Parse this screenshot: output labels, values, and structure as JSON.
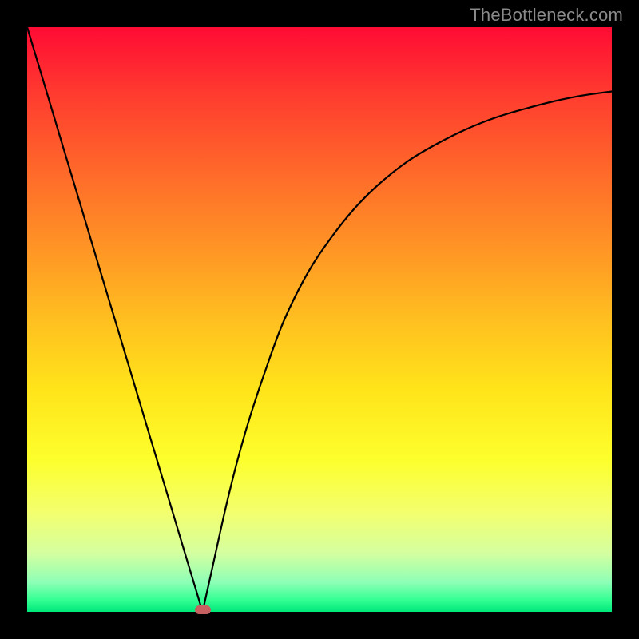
{
  "watermark": "TheBottleneck.com",
  "chart_data": {
    "type": "line",
    "title": "",
    "xlabel": "",
    "ylabel": "",
    "xlim": [
      0,
      100
    ],
    "ylim": [
      0,
      100
    ],
    "grid": false,
    "legend": false,
    "min_marker": {
      "x": 30,
      "y": 0
    },
    "gradient_stops": [
      {
        "pct": 0,
        "color": "#ff0b34"
      },
      {
        "pct": 12,
        "color": "#ff3d2f"
      },
      {
        "pct": 25,
        "color": "#ff6a2a"
      },
      {
        "pct": 38,
        "color": "#ff9525"
      },
      {
        "pct": 50,
        "color": "#ffbf20"
      },
      {
        "pct": 62,
        "color": "#ffe41a"
      },
      {
        "pct": 74,
        "color": "#fdff2c"
      },
      {
        "pct": 83,
        "color": "#f3ff6e"
      },
      {
        "pct": 90,
        "color": "#d4ffa0"
      },
      {
        "pct": 95,
        "color": "#8cffb6"
      },
      {
        "pct": 98,
        "color": "#33ff93"
      },
      {
        "pct": 100,
        "color": "#00e87a"
      }
    ],
    "series": [
      {
        "name": "bottleneck-curve",
        "x": [
          0,
          3,
          6,
          9,
          12,
          15,
          18,
          21,
          24,
          27,
          30,
          32,
          34,
          36,
          38,
          41,
          44,
          48,
          52,
          56,
          60,
          65,
          70,
          75,
          80,
          85,
          90,
          95,
          100
        ],
        "y": [
          100,
          90,
          80,
          70,
          60,
          50,
          40,
          30,
          20,
          10,
          0,
          9,
          18,
          26,
          33,
          42,
          50,
          58,
          64,
          69,
          73,
          77,
          80,
          82.5,
          84.5,
          86,
          87.3,
          88.3,
          89
        ]
      }
    ]
  }
}
